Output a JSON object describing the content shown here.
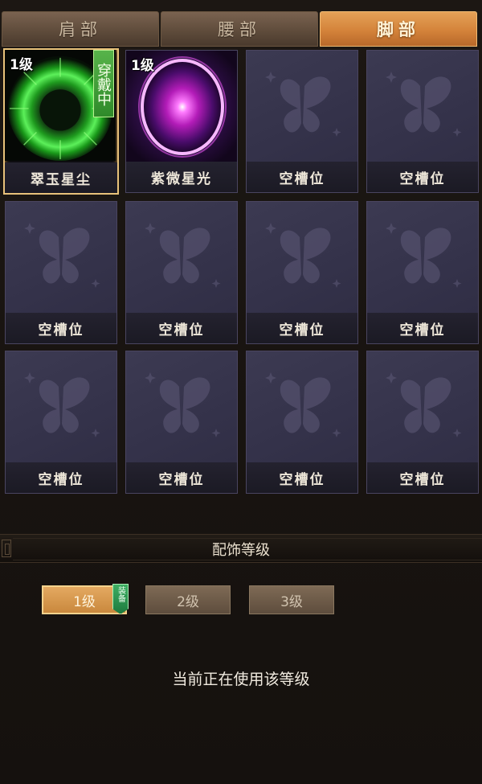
{
  "tabs": [
    {
      "label": "肩部",
      "active": false
    },
    {
      "label": "腰部",
      "active": false
    },
    {
      "label": "脚部",
      "active": true
    }
  ],
  "slots": {
    "s1": {
      "name": "翠玉星尘",
      "level": "1级",
      "status": "穿戴中",
      "glow": "#2bd62b"
    },
    "s2": {
      "name": "紫微星光",
      "level": "1级",
      "glow": "#d63bd8"
    },
    "empty_label": "空槽位"
  },
  "section_title": "配饰等级",
  "levels": [
    {
      "label": "1级",
      "active": true,
      "tag": "装备"
    },
    {
      "label": "2级",
      "active": false
    },
    {
      "label": "3级",
      "active": false
    }
  ],
  "status_text": "当前正在使用该等级",
  "colors": {
    "accent": "#d4833a",
    "slot_bg": "#34324a",
    "wearing_green": "#3c9a33"
  }
}
